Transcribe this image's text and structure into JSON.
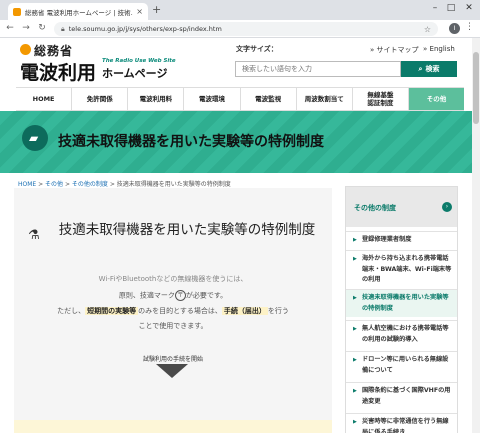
{
  "browser": {
    "tab_title": "総務省 電波利用ホームページ | 技術…",
    "tab_close": "×",
    "new_tab": "+",
    "url": "tele.soumu.go.jp/j/sys/others/exp-sp/index.htm",
    "profile_initial": "I"
  },
  "header": {
    "ministry": "総務省",
    "title": "電波利用",
    "sub_en": "The Radio Use Web Site",
    "sub_jp": "ホームページ",
    "text_size_label": "文字サイズ：",
    "sitemap": "サイトマップ",
    "english": "English",
    "search_placeholder": "検索したい語句を入力",
    "search_button": "検索"
  },
  "gnav": [
    {
      "label": "HOME"
    },
    {
      "label": "免許関係"
    },
    {
      "label": "電波利用料"
    },
    {
      "label": "電波環境"
    },
    {
      "label": "電波監視"
    },
    {
      "label": "周波数割当て"
    },
    {
      "label": "無線基盤\n認証制度"
    },
    {
      "label": "その他"
    }
  ],
  "hero": {
    "title": "技適未取得機器を用いた実験等の特例制度"
  },
  "breadcrumb": {
    "home": "HOME",
    "sep": " > ",
    "others": "その他",
    "system": "その他の制度",
    "current": "技適未取得機器を用いた実験等の特例制度"
  },
  "main": {
    "title": "技適未取得機器を用いた実験等の特例制度",
    "intro_1": "Wi-FiやBluetoothなどの無線機器を使うには、",
    "intro_2a": "原則、技適マーク",
    "intro_2b": "が必要です。",
    "intro_3a": "ただし、",
    "intro_3b": "短期間の実験等",
    "intro_3c": "のみを目的とする場合は、",
    "intro_3d": "手続（届出）",
    "intro_3e": "を行う",
    "intro_4": "ことで使用できます。",
    "start_link": "試験利用の手続を開始"
  },
  "sidebar": {
    "title": "その他の制度",
    "go_icon": "›",
    "items": [
      {
        "label": "登録修理業者制度"
      },
      {
        "label": "海外から持ち込まれる携帯電話端末・BWA端末、Wi-Fi端末等の利用"
      },
      {
        "label": "技適未取得機器を用いた実験等の特例制度"
      },
      {
        "label": "無人航空機における携帯電話等の利用の試験的導入"
      },
      {
        "label": "ドローン等に用いられる無線設備について"
      },
      {
        "label": "国際条約に基づく国際VHFの用途変更"
      },
      {
        "label": "災害時等に非常通信を行う無線局に係る手続き"
      }
    ]
  }
}
